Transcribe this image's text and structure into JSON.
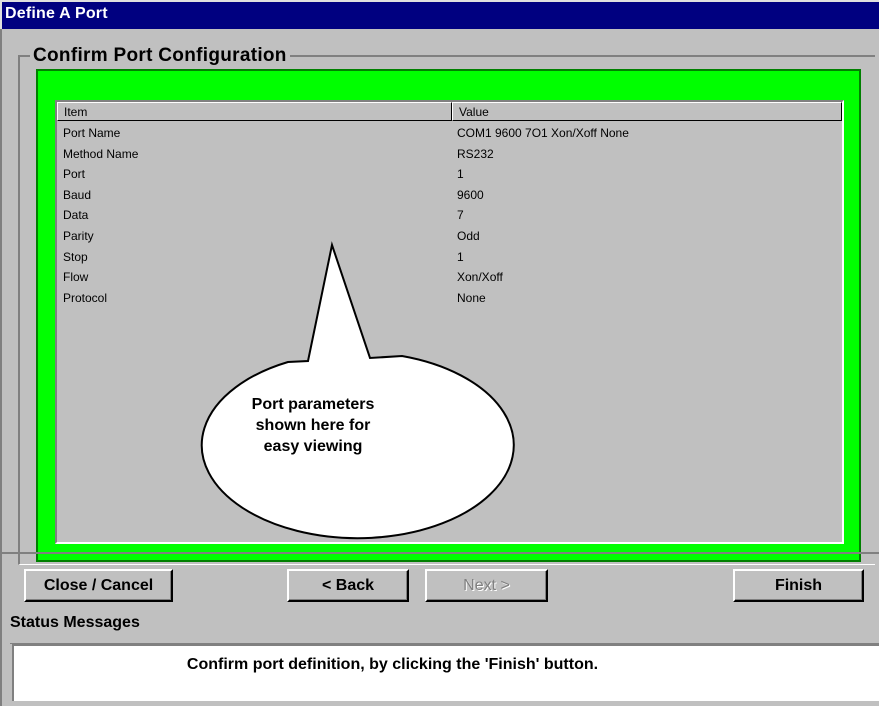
{
  "window": {
    "title": "Define A Port"
  },
  "group": {
    "title": "Confirm Port Configuration"
  },
  "list": {
    "columns": {
      "item": "Item",
      "value": "Value"
    },
    "rows": [
      {
        "item": "Port Name",
        "value": "COM1 9600 7O1 Xon/Xoff None"
      },
      {
        "item": "Method Name",
        "value": "RS232"
      },
      {
        "item": "Port",
        "value": "1"
      },
      {
        "item": "Baud",
        "value": "9600"
      },
      {
        "item": "Data",
        "value": "7"
      },
      {
        "item": "Parity",
        "value": "Odd"
      },
      {
        "item": "Stop",
        "value": "1"
      },
      {
        "item": "Flow",
        "value": "Xon/Xoff"
      },
      {
        "item": "Protocol",
        "value": "None"
      }
    ]
  },
  "callout": {
    "lines": [
      "Port parameters",
      "shown here for",
      "easy viewing"
    ]
  },
  "buttons": {
    "close_cancel": "Close / Cancel",
    "back": "< Back",
    "next": "Next >",
    "finish": "Finish"
  },
  "status": {
    "label": "Status Messages",
    "message": "Confirm port definition, by clicking the 'Finish' button."
  },
  "colors": {
    "titlebar": "#000080",
    "highlight_frame": "#00ff00",
    "window_bg": "#c0c0c0"
  }
}
